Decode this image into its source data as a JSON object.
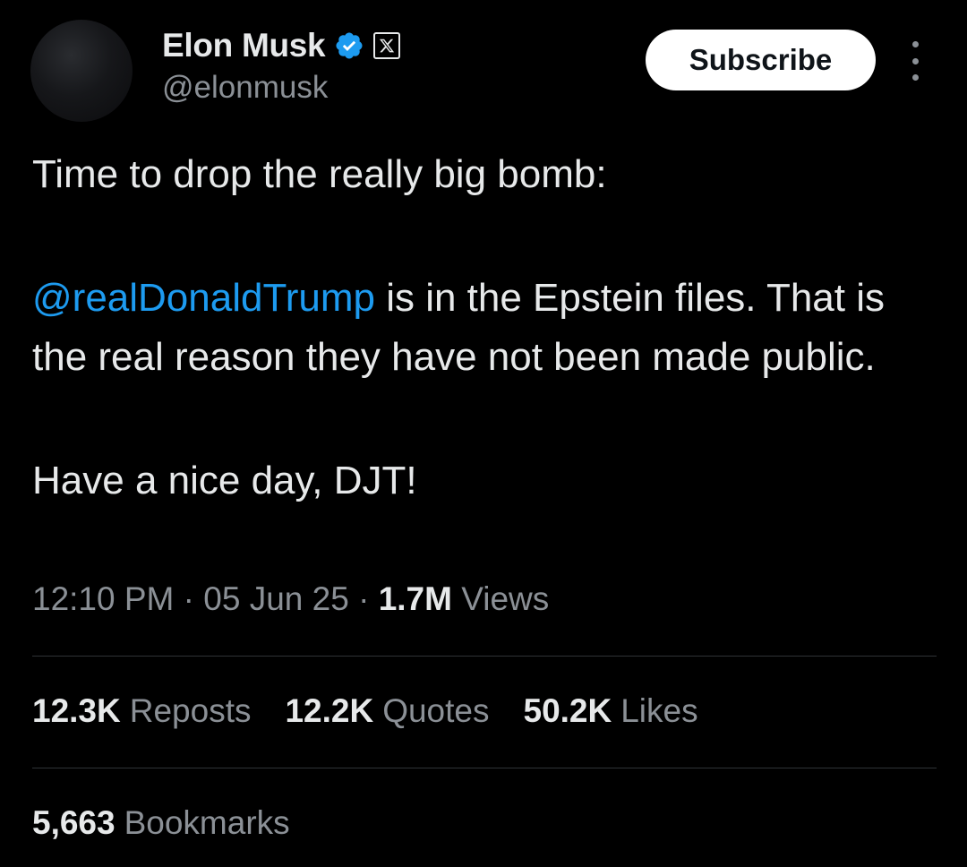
{
  "author": {
    "display_name": "Elon Musk",
    "handle": "@elonmusk",
    "verified_badge_color": "#1d9bf0",
    "affiliate_badge_icon": "x-logo-icon"
  },
  "header": {
    "subscribe_label": "Subscribe",
    "more_icon": "more-vertical-icon"
  },
  "tweet": {
    "line1": "Time to drop the really big bomb:",
    "mention": "@realDonaldTrump",
    "line2_rest": " is in the Epstein files. That is the real reason they have not been made public.",
    "line3": "Have a nice day, DJT!",
    "mention_color": "#1d9bf0"
  },
  "meta": {
    "time": "12:10 PM",
    "separator": " · ",
    "date": "05 Jun 25",
    "views_count": "1.7M",
    "views_label": " Views"
  },
  "stats": {
    "reposts_count": "12.3K",
    "reposts_label": "Reposts",
    "quotes_count": "12.2K",
    "quotes_label": "Quotes",
    "likes_count": "50.2K",
    "likes_label": "Likes",
    "bookmarks_count": "5,663",
    "bookmarks_label": "Bookmarks"
  },
  "colors": {
    "background": "#000000",
    "primary_text": "#e7e9ea",
    "secondary_text": "#8b9096",
    "divider": "#2f3336"
  }
}
